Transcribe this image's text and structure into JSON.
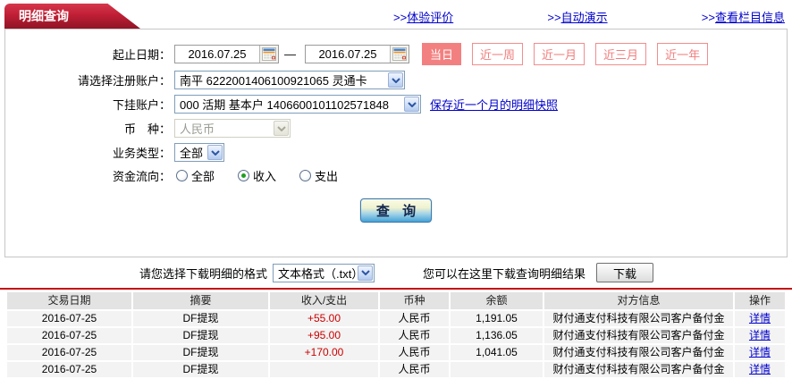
{
  "page": {
    "tab_title": "明细查询",
    "top_links": [
      {
        "prefix": ">>",
        "label": "体验评价"
      },
      {
        "prefix": ">>",
        "label": "自动演示"
      },
      {
        "prefix": ">>",
        "label": "查看栏目信息"
      }
    ]
  },
  "form": {
    "date_range": {
      "label": "起止日期：",
      "start": "2016.07.25",
      "separator": "—",
      "end": "2016.07.25"
    },
    "quick_ranges": [
      {
        "label": "当日",
        "active": true
      },
      {
        "label": "近一周",
        "active": false
      },
      {
        "label": "近一月",
        "active": false
      },
      {
        "label": "近三月",
        "active": false
      },
      {
        "label": "近一年",
        "active": false
      }
    ],
    "registered_account": {
      "label": "请选择注册账户：",
      "value": "南平 6222001406100921065 灵通卡"
    },
    "sub_account": {
      "label": "下挂账户：",
      "value": "000 活期 基本户 1406600101102571848",
      "snapshot_link": "保存近一个月的明细快照"
    },
    "currency": {
      "label": "币　种：",
      "value": "人民币",
      "disabled": true
    },
    "business_type": {
      "label": "业务类型：",
      "value": "全部"
    },
    "fund_flow": {
      "label": "资金流向：",
      "options": [
        {
          "label": "全部",
          "checked": false
        },
        {
          "label": "收入",
          "checked": true
        },
        {
          "label": "支出",
          "checked": false
        }
      ]
    },
    "query_button": "查 询"
  },
  "download": {
    "format_label": "请您选择下载明细的格式",
    "format_value": "文本格式（.txt）",
    "hint": "您可以在这里下载查询明细结果",
    "button": "下载"
  },
  "table": {
    "headers": [
      "交易日期",
      "摘要",
      "收入/支出",
      "币种",
      "余额",
      "对方信息",
      "操作"
    ],
    "rows": [
      {
        "date": "2016-07-25",
        "summary": "DF提现",
        "amount": "+55.00",
        "currency": "人民币",
        "balance": "1,191.05",
        "counterparty": "财付通支付科技有限公司客户备付金",
        "action": "详情"
      },
      {
        "date": "2016-07-25",
        "summary": "DF提现",
        "amount": "+95.00",
        "currency": "人民币",
        "balance": "1,136.05",
        "counterparty": "财付通支付科技有限公司客户备付金",
        "action": "详情"
      },
      {
        "date": "2016-07-25",
        "summary": "DF提现",
        "amount": "+170.00",
        "currency": "人民币",
        "balance": "1,041.05",
        "counterparty": "财付通支付科技有限公司客户备付金",
        "action": "详情"
      },
      {
        "date": "2016-07-25",
        "summary": "DF提现",
        "amount": "",
        "currency": "人民币",
        "balance": "",
        "counterparty": "财付通支付科技有限公司客户备付金",
        "action": "详情"
      }
    ]
  },
  "colors": {
    "tab_red": "#b81f33",
    "quick_btn_salmon": "#f38080",
    "link_blue": "#0000cc",
    "amount_red": "#cc0000",
    "divider_red": "#c41414",
    "query_btn_blue": "#45a2d4"
  }
}
